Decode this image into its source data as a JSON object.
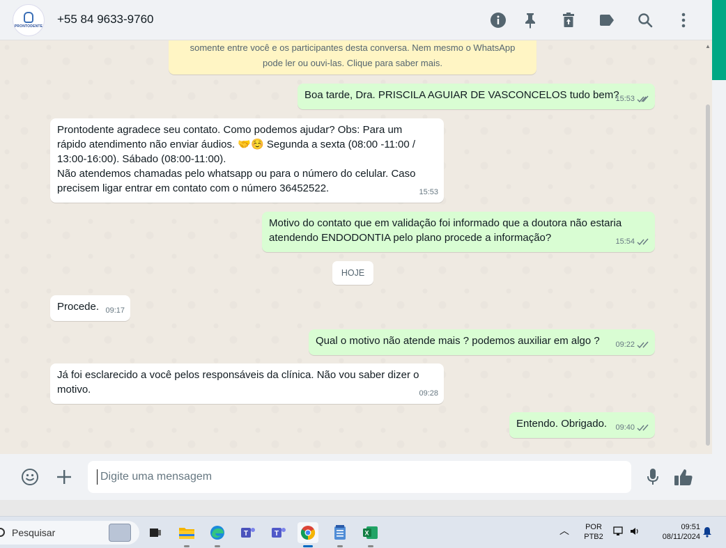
{
  "header": {
    "avatar_logo": "PRONTODENTE",
    "contact": "+55 84 9633-9760",
    "icons": [
      "info-icon",
      "pin-icon",
      "trash-icon",
      "label-icon",
      "search-icon",
      "menu-icon"
    ]
  },
  "encryption_notice": {
    "line1": "somente entre você e os participantes desta conversa. Nem mesmo o WhatsApp",
    "line2": "pode ler ou ouvi-las. Clique para saber mais."
  },
  "messages": [
    {
      "dir": "out",
      "text": "Boa tarde, Dra. PRISCILA AGUIAR DE VASCONCELOS tudo bem?",
      "time": "15:53"
    },
    {
      "dir": "in",
      "lines": [
        "Prontodente agradece seu contato. Como podemos ajudar? Obs: Para um",
        "rápido atendimento não enviar áudios. 🤝☺️ Segunda a sexta (08:00 -11:00 /",
        "13:00-16:00). Sábado (08:00-11:00).",
        "Não atendemos chamadas pelo whatsapp ou para o número do celular. Caso",
        "precisem ligar entrar em contato com o número 36452522."
      ],
      "time": "15:53"
    },
    {
      "dir": "out",
      "lines": [
        "Motivo do contato que em validação foi informado que a doutora não estaria",
        "atendendo ENDODONTIA pelo plano procede a informação?"
      ],
      "time": "15:54"
    },
    {
      "dir": "in",
      "text": "Procede.",
      "time": "09:17"
    },
    {
      "dir": "out",
      "text": "Qual o motivo não atende mais ? podemos auxiliar em algo ?",
      "time": "09:22"
    },
    {
      "dir": "in",
      "lines": [
        "Já foi esclarecido a você pelos responsáveis da clínica. Não vou saber dizer o",
        "motivo."
      ],
      "time": "09:28"
    },
    {
      "dir": "out",
      "text": "Entendo. Obrigado.",
      "time": "09:40"
    }
  ],
  "date_divider": "HOJE",
  "composer": {
    "placeholder": "Digite uma mensagem"
  },
  "taskbar": {
    "search_label": "Pesquisar",
    "lang_line1": "POR",
    "lang_line2": "PTB2",
    "time": "09:51",
    "date": "08/11/2024"
  },
  "colors": {
    "outgoing_bubble": "#d9fdd3",
    "incoming_bubble": "#ffffff",
    "accent": "#00a884",
    "read_ticks": "#667781"
  }
}
